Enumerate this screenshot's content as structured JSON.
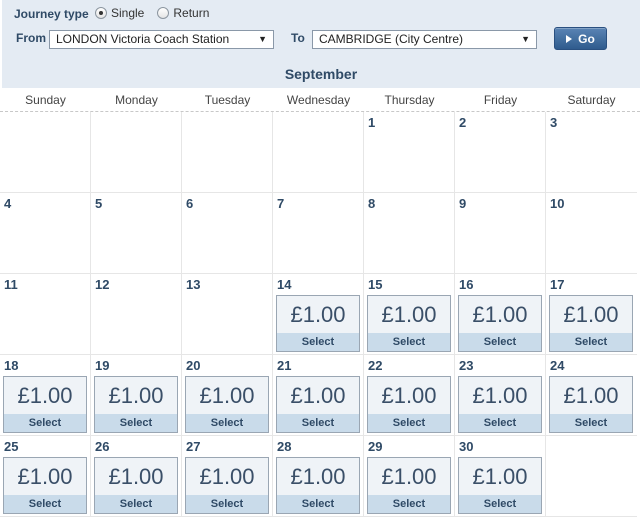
{
  "form": {
    "journey_type_label": "Journey type",
    "journey_options": [
      {
        "label": "Single",
        "selected": true
      },
      {
        "label": "Return",
        "selected": false
      }
    ],
    "from_label": "From",
    "from_value": "LONDON Victoria Coach Station",
    "to_label": "To",
    "to_value": "CAMBRIDGE (City Centre)",
    "go_label": "Go"
  },
  "calendar": {
    "month": "September",
    "weekdays": [
      "Sunday",
      "Monday",
      "Tuesday",
      "Wednesday",
      "Thursday",
      "Friday",
      "Saturday"
    ],
    "first_weekday_index": 4,
    "days_in_month": 30,
    "fares": [
      {
        "day": 14,
        "price": "£1.00",
        "action": "Select"
      },
      {
        "day": 15,
        "price": "£1.00",
        "action": "Select"
      },
      {
        "day": 16,
        "price": "£1.00",
        "action": "Select"
      },
      {
        "day": 17,
        "price": "£1.00",
        "action": "Select"
      },
      {
        "day": 18,
        "price": "£1.00",
        "action": "Select"
      },
      {
        "day": 19,
        "price": "£1.00",
        "action": "Select"
      },
      {
        "day": 20,
        "price": "£1.00",
        "action": "Select"
      },
      {
        "day": 21,
        "price": "£1.00",
        "action": "Select"
      },
      {
        "day": 22,
        "price": "£1.00",
        "action": "Select"
      },
      {
        "day": 23,
        "price": "£1.00",
        "action": "Select"
      },
      {
        "day": 24,
        "price": "£1.00",
        "action": "Select"
      },
      {
        "day": 25,
        "price": "£1.00",
        "action": "Select"
      },
      {
        "day": 26,
        "price": "£1.00",
        "action": "Select"
      },
      {
        "day": 27,
        "price": "£1.00",
        "action": "Select"
      },
      {
        "day": 28,
        "price": "£1.00",
        "action": "Select"
      },
      {
        "day": 29,
        "price": "£1.00",
        "action": "Select"
      },
      {
        "day": 30,
        "price": "£1.00",
        "action": "Select"
      }
    ]
  },
  "colors": {
    "panel_bg": "#e4ebf3",
    "heading": "#2f4a66",
    "go_button": "#3b6698",
    "fare_price_bg": "#eff3f7",
    "fare_select_bg": "#c9dbea"
  }
}
